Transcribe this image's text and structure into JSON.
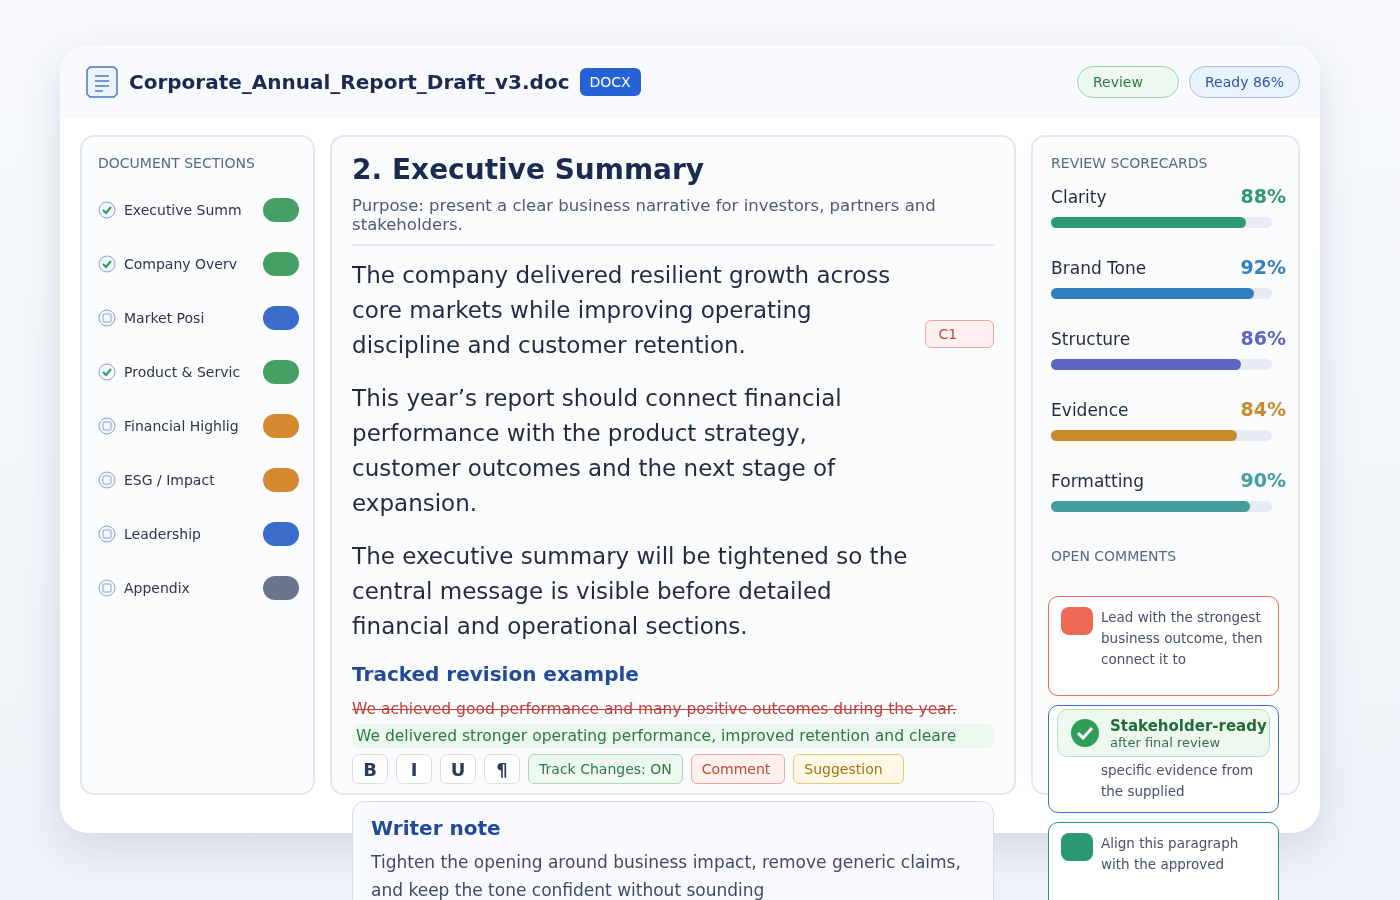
{
  "header": {
    "title": "Corporate_Annual_Report_Draft_v3.doc",
    "format_badge": "DOCX",
    "status_pills": [
      "Review",
      "Ready 86%"
    ]
  },
  "sections": {
    "title": "DOCUMENT SECTIONS",
    "items": [
      {
        "label": "Executive Summ",
        "checked": true,
        "color": "#46a065"
      },
      {
        "label": "Company Overv",
        "checked": true,
        "color": "#46a065"
      },
      {
        "label": "Market Posi",
        "checked": false,
        "color": "#3a6ccc"
      },
      {
        "label": "Product & Servic",
        "checked": true,
        "color": "#46a065"
      },
      {
        "label": "Financial Highlig",
        "checked": false,
        "color": "#d68a30"
      },
      {
        "label": "ESG / Impact",
        "checked": false,
        "color": "#d68a30"
      },
      {
        "label": "Leadership",
        "checked": false,
        "color": "#3a6ccc"
      },
      {
        "label": "Appendix",
        "checked": false,
        "color": "#6b768c"
      }
    ]
  },
  "document": {
    "heading": "2. Executive Summary",
    "purpose": "Purpose: present a clear business narrative for investors, partners and stakeholders.",
    "paragraphs": [
      "The company delivered resilient growth across core markets while improving operating discipline and customer retention.",
      "This year’s report should connect financial performance with the product strategy, customer outcomes and the next stage of expansion.",
      "The executive summary will be tightened so the central message is visible before detailed financial and operational sections."
    ],
    "comment_tag": "C1",
    "revision_title": "Tracked revision example",
    "deleted": "We achieved good performance and many positive outcomes during the year.",
    "inserted": "We delivered stronger operating performance, improved retention and cleare",
    "toolbar": {
      "format_buttons": [
        "B",
        "I",
        "U",
        "¶"
      ],
      "chips": [
        {
          "label": "Track Changes: ON",
          "kind": "track"
        },
        {
          "label": "Comment",
          "kind": "comment"
        },
        {
          "label": "Suggestion",
          "kind": "suggestion"
        }
      ]
    }
  },
  "writer_note": {
    "title": "Writer note",
    "text": "Tighten the opening around business impact, remove generic claims, and keep the tone confident without sounding"
  },
  "scorecards": {
    "title": "REVIEW SCORECARDS",
    "items": [
      {
        "label": "Clarity",
        "value": "88%",
        "level": 0.88,
        "color": "#2e9a74"
      },
      {
        "label": "Brand Tone",
        "value": "92%",
        "level": 0.92,
        "color": "#327fc2"
      },
      {
        "label": "Structure",
        "value": "86%",
        "level": 0.86,
        "color": "#5c66c6"
      },
      {
        "label": "Evidence",
        "value": "84%",
        "level": 0.84,
        "color": "#c98a2a"
      },
      {
        "label": "Formatting",
        "value": "90%",
        "level": 0.9,
        "color": "#459d9e"
      }
    ]
  },
  "comments": {
    "title": "OPEN COMMENTS",
    "items": [
      {
        "text": "Lead with the strongest business outcome, then connect it to",
        "color": "#ef6a55"
      },
      {
        "text": "specific evidence from the supplied"
      },
      {
        "text": "Align this paragraph with the approved",
        "color": "#2a9873"
      }
    ]
  },
  "ready_badge": {
    "title": "Stakeholder-ready",
    "subtitle": "after final review"
  }
}
